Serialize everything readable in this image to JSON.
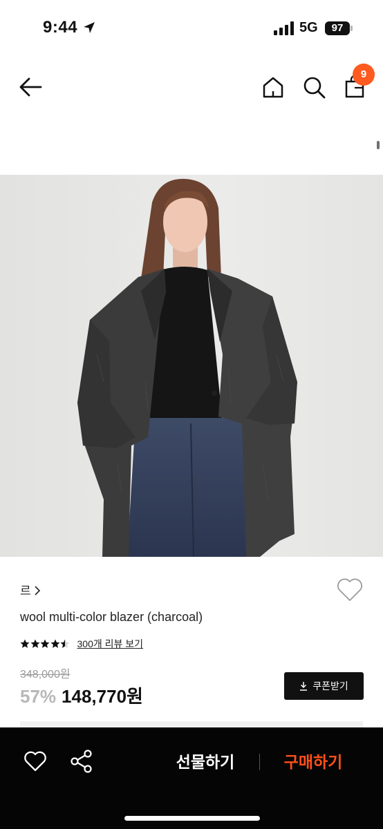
{
  "status_bar": {
    "time": "9:44",
    "network": "5G",
    "battery": "97",
    "icons": [
      "location-arrow-icon",
      "signal-bars-icon",
      "battery-icon"
    ]
  },
  "nav": {
    "icons": [
      "back-arrow-icon",
      "home-icon",
      "search-icon",
      "shopping-bag-icon"
    ],
    "cart_count": "9"
  },
  "product": {
    "brand": "르",
    "name": "wool multi-color blazer (charcoal)",
    "rating": 4.5,
    "rating_max": 5,
    "review_link": "300개 리뷰 보기",
    "original_price": "348,000원",
    "discount": "57%",
    "sale_price": "148,770원",
    "coupon_label": "쿠폰받기",
    "image": "model wearing charcoal wool blazer, black top and dark denim jeans"
  },
  "bottom_bar": {
    "icons": [
      "heart-outline-icon",
      "share-icon"
    ],
    "gift_label": "선물하기",
    "buy_label": "구매하기"
  },
  "colors": {
    "accent": "#ff5a1f",
    "buy": "#ff4f1a",
    "bar_background": "#050505",
    "coupon_background": "#111111"
  }
}
